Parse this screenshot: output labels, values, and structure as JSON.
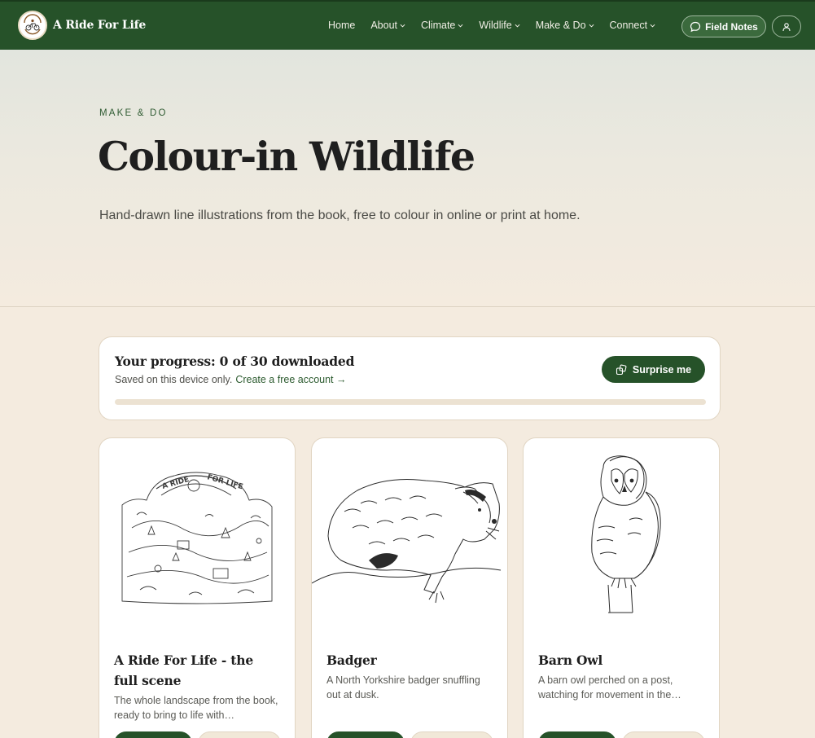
{
  "site": {
    "name": "A Ride For Life"
  },
  "nav": {
    "items": [
      {
        "label": "Home",
        "dropdown": false
      },
      {
        "label": "About",
        "dropdown": true
      },
      {
        "label": "Climate",
        "dropdown": true
      },
      {
        "label": "Wildlife",
        "dropdown": true
      },
      {
        "label": "Make & Do",
        "dropdown": true
      },
      {
        "label": "Connect",
        "dropdown": true
      }
    ],
    "field_notes_label": "Field Notes"
  },
  "hero": {
    "eyebrow": "MAKE & DO",
    "title": "Colour-in Wildlife",
    "subtitle": "Hand-drawn line illustrations from the book, free to colour in online or print at home."
  },
  "progress": {
    "title": "Your progress: 0 of 30 downloaded",
    "note": "Saved on this device only.",
    "account_link": "Create a free account →",
    "surprise_label": "Surprise me",
    "downloaded": 0,
    "total": 30
  },
  "cards": [
    {
      "title": "A Ride For Life - the full scene",
      "description": "The whole landscape from the book, ready to bring to life with…",
      "illustration": "full-scene"
    },
    {
      "title": "Badger",
      "description": "A North Yorkshire badger snuffling out at dusk.",
      "illustration": "badger"
    },
    {
      "title": "Barn Owl",
      "description": "A barn owl perched on a post, watching for movement in the…",
      "illustration": "barn-owl"
    }
  ],
  "colors": {
    "brand_green": "#265229",
    "page_cream": "#f4ebdf",
    "card_border": "#e1d5c3"
  }
}
